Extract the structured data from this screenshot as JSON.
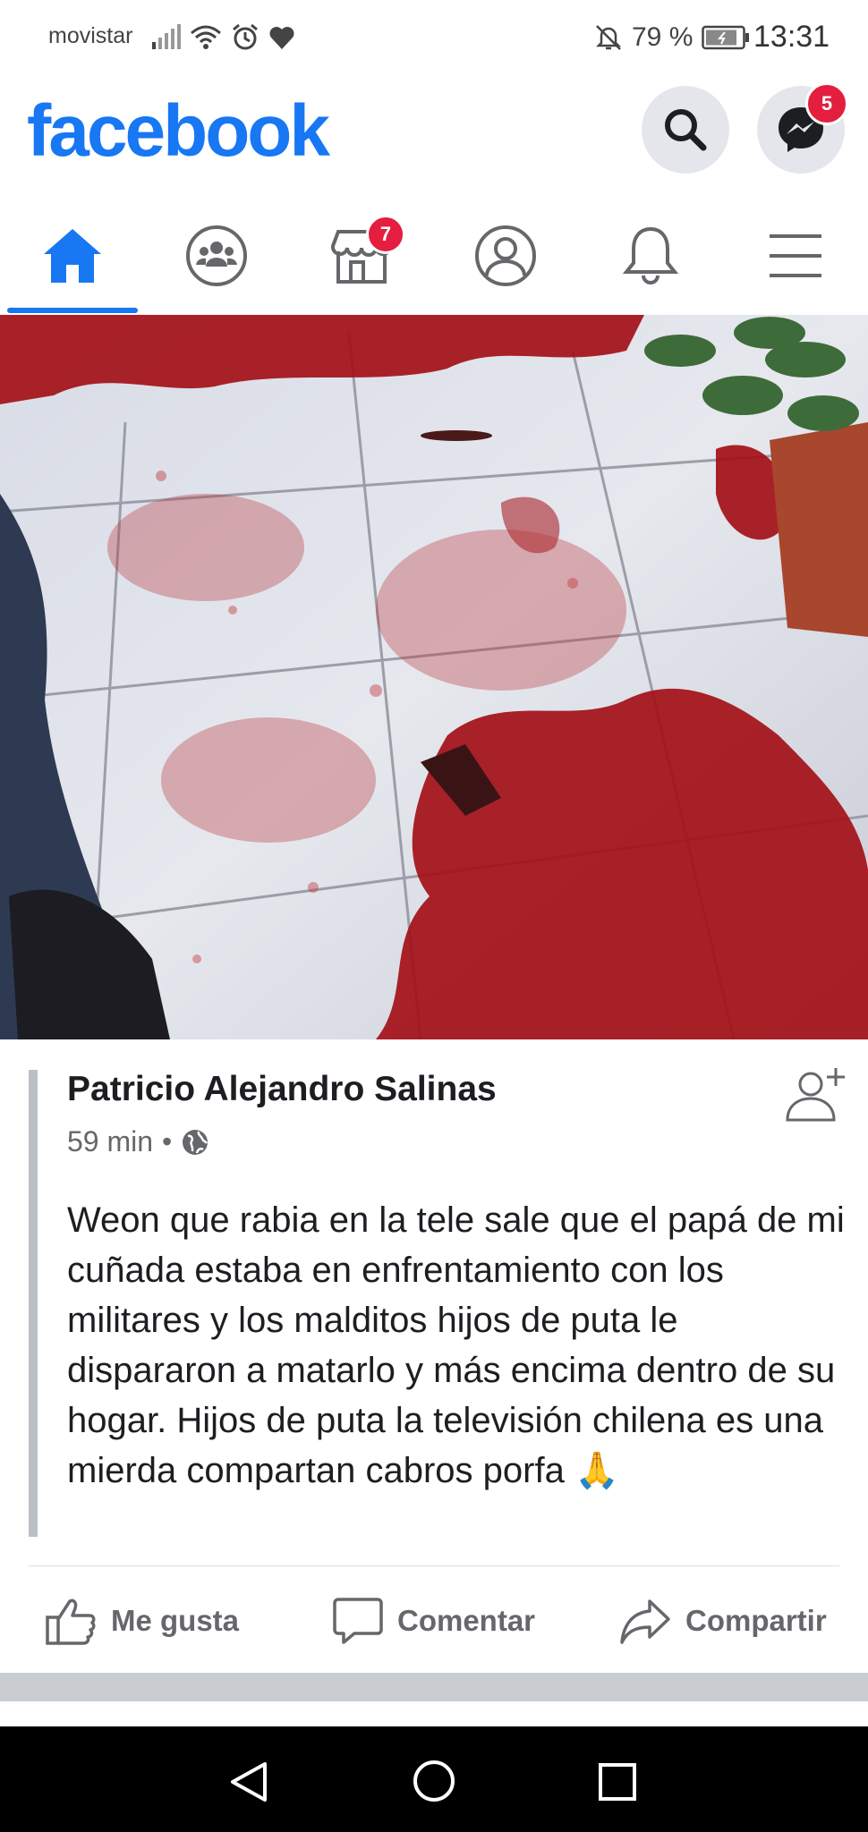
{
  "status_bar": {
    "carrier": "movistar",
    "battery": "79 %",
    "time": "13:31",
    "icons": [
      "signal-icon",
      "wifi-icon",
      "alarm-icon",
      "heart-icon",
      "mute-icon",
      "battery-icon"
    ]
  },
  "header": {
    "logo": "facebook",
    "messenger_badge": "5",
    "brand_color": "#1877f2"
  },
  "nav": {
    "tabs": [
      {
        "name": "home",
        "icon": "home-icon",
        "active": true
      },
      {
        "name": "groups",
        "icon": "groups-icon"
      },
      {
        "name": "marketplace",
        "icon": "marketplace-icon",
        "badge": "7"
      },
      {
        "name": "profile",
        "icon": "profile-icon"
      },
      {
        "name": "notifications",
        "icon": "bell-icon"
      },
      {
        "name": "menu",
        "icon": "hamburger-menu-icon"
      }
    ]
  },
  "post": {
    "author": "Patricio Alejandro Salinas",
    "time": "59 min",
    "separator": "•",
    "text": "Weon que rabia en la tele sale que el papá de mi cuñada estaba en enfrentamiento con los militares y los malditos hijos de puta le dispararon a matarlo y más encima dentro de su hogar. Hijos de puta la televisión chilena es una mierda  compartan cabros porfa",
    "emoji": "🙏",
    "actions": {
      "like": "Me gusta",
      "comment": "Comentar",
      "share": "Compartir"
    }
  }
}
